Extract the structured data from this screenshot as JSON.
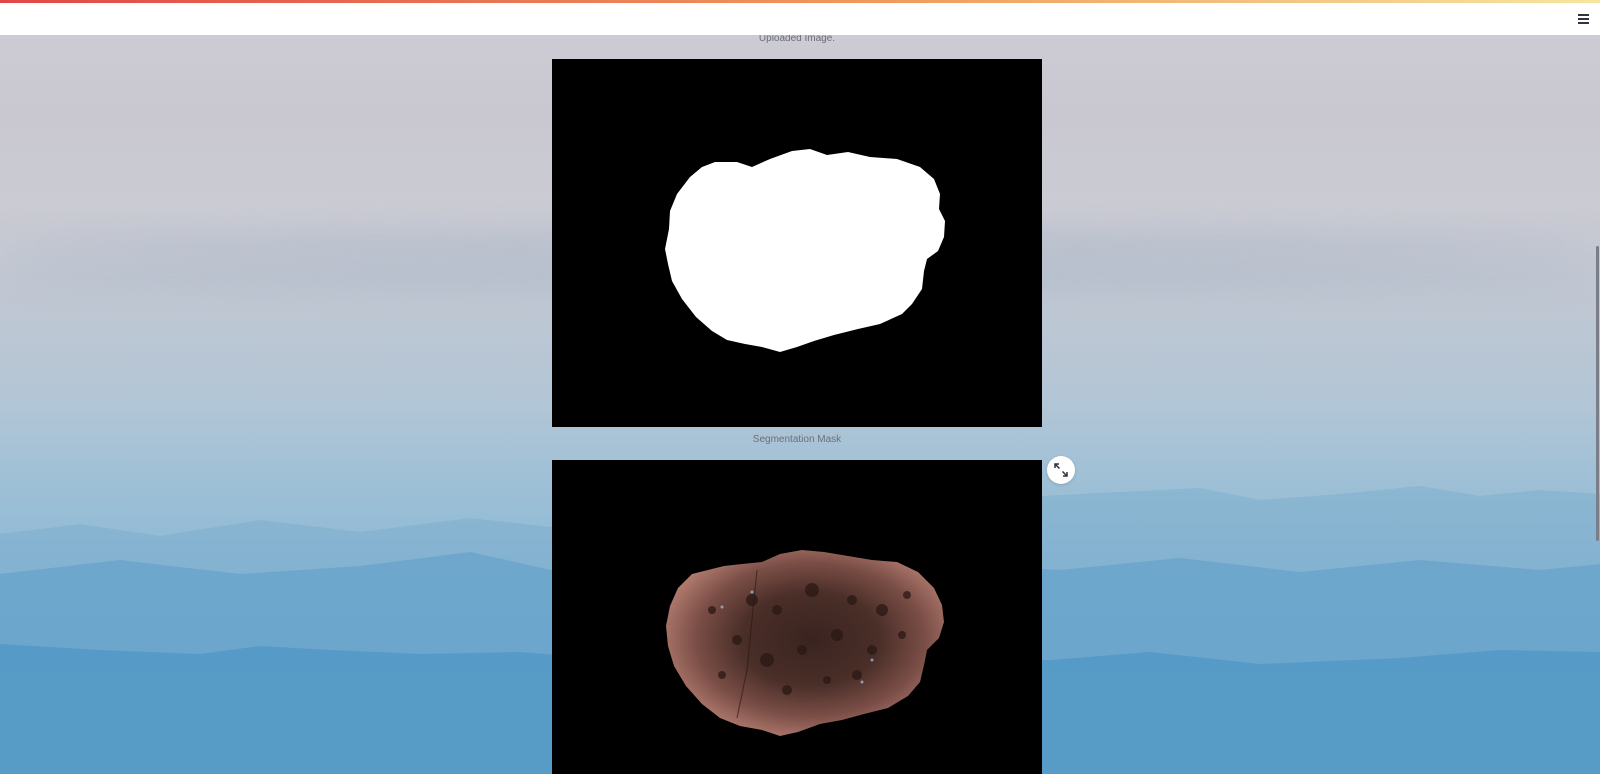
{
  "header": {
    "menu_icon": "hamburger-menu-icon"
  },
  "images": [
    {
      "caption": "Uploaded Image.",
      "kind": "segmentation-mask"
    },
    {
      "caption": "Segmentation Mask",
      "kind": "segmented-lesion"
    }
  ],
  "controls": {
    "expand_icon": "fullscreen-expand-icon"
  },
  "colors": {
    "accent_start": "#e04848",
    "accent_mid": "#f09a5c",
    "accent_end": "#f5e6a0",
    "mask_fg": "#ffffff",
    "mask_bg": "#000000"
  }
}
